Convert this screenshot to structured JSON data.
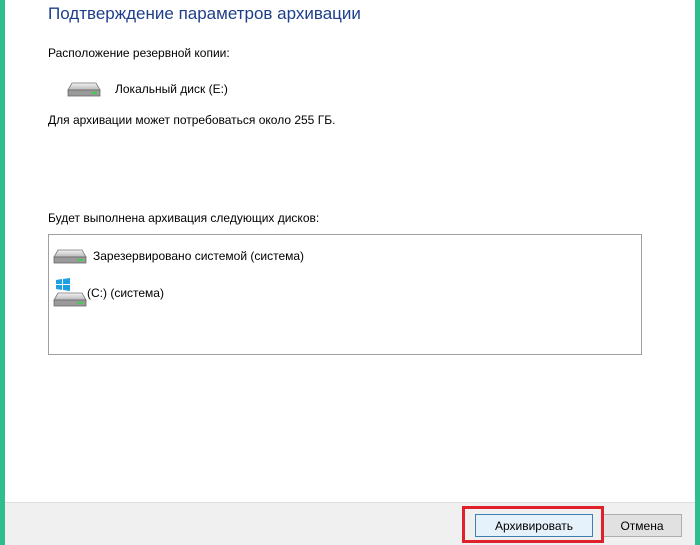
{
  "dialog": {
    "title": "Подтверждение параметров архивации",
    "location_label": "Расположение резервной копии:",
    "backup_target": "Локальный диск (E:)",
    "size_note": "Для архивации может потребоваться около 255 ГБ.",
    "disks_label": "Будет выполнена архивация следующих дисков:",
    "disks": [
      {
        "label": "Зарезервировано системой (система)",
        "icon": "hard-drive-icon"
      },
      {
        "label": "(C:) (система)",
        "icon": "windows-drive-icon"
      }
    ]
  },
  "footer": {
    "backup_button": "Архивировать",
    "cancel_button": "Отмена"
  },
  "colors": {
    "accent_frame": "#2ebd8f",
    "title_text": "#1e3e8c",
    "highlight": "#e0202a",
    "windows_logo": "#1fa0e0"
  }
}
